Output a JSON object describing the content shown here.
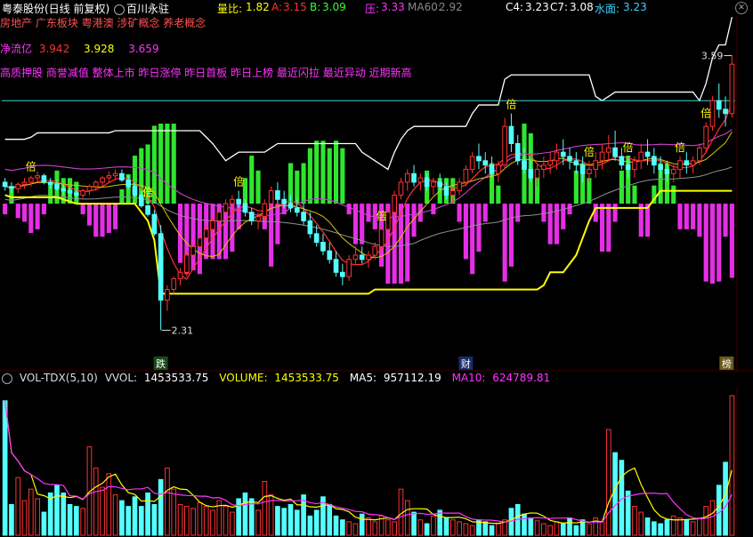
{
  "header": {
    "stock_name": "粤泰股份(日线 前复权)",
    "indicator_name": "百川永驻",
    "ratio_label": "量比:",
    "ratio_value": "1.82",
    "a_label": "A:",
    "a_value": "3.15",
    "b_label": "B:",
    "b_value": "3.09",
    "ya_label": "压:",
    "ya_value": "3.33",
    "ma60_label": "MA60:",
    "ma60_value": "2.92",
    "c4_label": "C4:",
    "c4_value": "3.23",
    "c7_label": "C7:",
    "c7_value": "3.08",
    "water_label": "水面:",
    "water_value": "3.23"
  },
  "concepts": "房地产 广东板块 粤港澳 涉矿概念 养老概念",
  "net_inflow": {
    "label": "净流亿",
    "v1": "3.942",
    "v2": "3.928",
    "v3": "3.659"
  },
  "tags": "高质押股 商誉减值 整体上市 昨日涨停 昨日首板 昨日上榜 最近闪拉 最近异动 近期新高",
  "annotations": {
    "high_label": "3.59",
    "low_label": "2.31",
    "bei": "倍",
    "die": "跌",
    "cai": "财",
    "bang": "榜"
  },
  "volume_header": {
    "name": "VOL-TDX(5,10)",
    "vvol_label": "VVOL:",
    "vvol_value": "1453533.75",
    "volume_label": "VOLUME:",
    "volume_value": "1453533.75",
    "ma5_label": "MA5:",
    "ma5_value": "957112.19",
    "ma10_label": "MA10:",
    "ma10_value": "624789.81"
  },
  "colors": {
    "bg": "#000000",
    "up": "#ff3232",
    "down": "#54ffff",
    "yellow": "#ffff00",
    "magenta": "#ff33ff",
    "green": "#33ff33",
    "white": "#ffffff",
    "cyan_line": "#40d0d0",
    "purple_line": "#d040d0"
  },
  "chart_data": [
    {
      "type": "candlestick",
      "price_range": [
        2.2,
        3.7
      ],
      "high_marker": 3.59,
      "low_marker": 2.31,
      "candles": [
        [
          3.0,
          3.02,
          2.96,
          2.98
        ],
        [
          2.98,
          3.0,
          2.95,
          2.97
        ],
        [
          2.97,
          3.0,
          2.95,
          2.99
        ],
        [
          2.99,
          3.02,
          2.97,
          3.0
        ],
        [
          3.0,
          3.03,
          2.98,
          3.02
        ],
        [
          3.02,
          3.05,
          3.0,
          3.03
        ],
        [
          3.03,
          3.04,
          2.99,
          3.0
        ],
        [
          3.0,
          3.02,
          2.97,
          2.99
        ],
        [
          2.99,
          3.01,
          2.96,
          2.97
        ],
        [
          2.97,
          2.99,
          2.94,
          2.96
        ],
        [
          2.96,
          2.98,
          2.93,
          2.95
        ],
        [
          2.95,
          2.97,
          2.92,
          2.94
        ],
        [
          2.94,
          2.97,
          2.92,
          2.96
        ],
        [
          2.96,
          2.99,
          2.94,
          2.98
        ],
        [
          2.98,
          3.01,
          2.96,
          3.0
        ],
        [
          3.0,
          3.03,
          2.98,
          3.02
        ],
        [
          3.02,
          3.05,
          3.0,
          3.03
        ],
        [
          3.03,
          3.06,
          3.01,
          3.04
        ],
        [
          3.04,
          3.06,
          3.0,
          3.01
        ],
        [
          3.01,
          3.03,
          2.97,
          2.98
        ],
        [
          2.98,
          3.0,
          2.93,
          2.94
        ],
        [
          2.94,
          2.96,
          2.88,
          2.89
        ],
        [
          2.89,
          2.91,
          2.84,
          2.85
        ],
        [
          2.85,
          2.87,
          2.75,
          2.76
        ],
        [
          2.76,
          2.8,
          2.31,
          2.45
        ],
        [
          2.45,
          2.52,
          2.4,
          2.5
        ],
        [
          2.5,
          2.56,
          2.48,
          2.55
        ],
        [
          2.55,
          2.6,
          2.52,
          2.58
        ],
        [
          2.58,
          2.68,
          2.56,
          2.66
        ],
        [
          2.66,
          2.72,
          2.64,
          2.7
        ],
        [
          2.7,
          2.76,
          2.68,
          2.74
        ],
        [
          2.74,
          2.8,
          2.72,
          2.78
        ],
        [
          2.78,
          2.84,
          2.76,
          2.82
        ],
        [
          2.82,
          2.88,
          2.8,
          2.86
        ],
        [
          2.86,
          2.92,
          2.84,
          2.9
        ],
        [
          2.9,
          2.94,
          2.86,
          2.92
        ],
        [
          2.92,
          2.96,
          2.88,
          2.9
        ],
        [
          2.9,
          2.92,
          2.84,
          2.86
        ],
        [
          2.86,
          2.88,
          2.8,
          2.82
        ],
        [
          2.82,
          2.86,
          2.78,
          2.84
        ],
        [
          2.84,
          2.92,
          2.82,
          2.9
        ],
        [
          2.9,
          2.98,
          2.88,
          2.96
        ],
        [
          2.96,
          3.0,
          2.9,
          2.92
        ],
        [
          2.92,
          2.96,
          2.88,
          2.9
        ],
        [
          2.9,
          2.94,
          2.86,
          2.88
        ],
        [
          2.88,
          2.92,
          2.84,
          2.86
        ],
        [
          2.86,
          2.9,
          2.8,
          2.82
        ],
        [
          2.82,
          2.86,
          2.74,
          2.76
        ],
        [
          2.76,
          2.8,
          2.7,
          2.72
        ],
        [
          2.72,
          2.76,
          2.66,
          2.68
        ],
        [
          2.68,
          2.72,
          2.62,
          2.64
        ],
        [
          2.64,
          2.68,
          2.56,
          2.58
        ],
        [
          2.58,
          2.62,
          2.52,
          2.56
        ],
        [
          2.56,
          2.66,
          2.54,
          2.64
        ],
        [
          2.64,
          2.7,
          2.62,
          2.66
        ],
        [
          2.66,
          2.7,
          2.62,
          2.64
        ],
        [
          2.64,
          2.68,
          2.6,
          2.66
        ],
        [
          2.66,
          2.72,
          2.64,
          2.7
        ],
        [
          2.7,
          2.8,
          2.68,
          2.78
        ],
        [
          2.78,
          2.88,
          2.76,
          2.86
        ],
        [
          2.86,
          2.96,
          2.84,
          2.94
        ],
        [
          2.94,
          3.02,
          2.92,
          3.0
        ],
        [
          3.0,
          3.06,
          2.96,
          3.04
        ],
        [
          3.04,
          3.08,
          2.98,
          3.0
        ],
        [
          3.0,
          3.04,
          2.96,
          3.02
        ],
        [
          3.02,
          3.04,
          2.96,
          2.98
        ],
        [
          2.98,
          3.02,
          2.94,
          3.0
        ],
        [
          3.0,
          3.04,
          2.96,
          2.98
        ],
        [
          2.98,
          3.0,
          2.92,
          2.94
        ],
        [
          2.94,
          2.98,
          2.9,
          2.96
        ],
        [
          2.96,
          3.02,
          2.94,
          3.0
        ],
        [
          3.0,
          3.08,
          2.98,
          3.06
        ],
        [
          3.06,
          3.14,
          3.04,
          3.12
        ],
        [
          3.12,
          3.18,
          3.06,
          3.1
        ],
        [
          3.1,
          3.14,
          3.04,
          3.08
        ],
        [
          3.08,
          3.12,
          3.02,
          3.04
        ],
        [
          3.04,
          3.1,
          3.0,
          3.08
        ],
        [
          3.08,
          3.3,
          3.06,
          3.26
        ],
        [
          3.26,
          3.32,
          3.14,
          3.18
        ],
        [
          3.18,
          3.22,
          3.08,
          3.1
        ],
        [
          3.1,
          3.16,
          3.04,
          3.06
        ],
        [
          3.06,
          3.1,
          3.0,
          3.02
        ],
        [
          3.02,
          3.08,
          2.98,
          3.06
        ],
        [
          3.06,
          3.12,
          3.02,
          3.08
        ],
        [
          3.08,
          3.14,
          3.04,
          3.1
        ],
        [
          3.1,
          3.18,
          3.06,
          3.14
        ],
        [
          3.14,
          3.2,
          3.08,
          3.12
        ],
        [
          3.12,
          3.16,
          3.06,
          3.1
        ],
        [
          3.1,
          3.14,
          3.04,
          3.08
        ],
        [
          3.08,
          3.12,
          3.0,
          3.04
        ],
        [
          3.04,
          3.1,
          3.0,
          3.06
        ],
        [
          3.06,
          3.14,
          3.02,
          3.1
        ],
        [
          3.1,
          3.18,
          3.06,
          3.14
        ],
        [
          3.14,
          3.22,
          3.1,
          3.16
        ],
        [
          3.16,
          3.24,
          3.1,
          3.12
        ],
        [
          3.12,
          3.16,
          3.06,
          3.08
        ],
        [
          3.08,
          3.12,
          3.02,
          3.06
        ],
        [
          3.06,
          3.12,
          3.02,
          3.1
        ],
        [
          3.1,
          3.18,
          3.06,
          3.14
        ],
        [
          3.14,
          3.2,
          3.08,
          3.12
        ],
        [
          3.12,
          3.16,
          3.04,
          3.08
        ],
        [
          3.08,
          3.12,
          3.02,
          3.06
        ],
        [
          3.06,
          3.1,
          3.0,
          3.04
        ],
        [
          3.04,
          3.08,
          3.0,
          3.06
        ],
        [
          3.06,
          3.12,
          3.02,
          3.1
        ],
        [
          3.1,
          3.14,
          3.04,
          3.08
        ],
        [
          3.08,
          3.12,
          3.04,
          3.1
        ],
        [
          3.1,
          3.18,
          3.08,
          3.16
        ],
        [
          3.16,
          3.28,
          3.14,
          3.26
        ],
        [
          3.26,
          3.4,
          3.24,
          3.38
        ],
        [
          3.38,
          3.46,
          3.3,
          3.34
        ],
        [
          3.34,
          3.4,
          3.26,
          3.32
        ],
        [
          3.32,
          3.59,
          3.3,
          3.55
        ]
      ]
    },
    {
      "type": "bar",
      "series": [
        {
          "name": "VOLUME",
          "values": [
            1400000,
            320000,
            600000,
            360000,
            480000,
            380000,
            240000,
            440000,
            520000,
            440000,
            320000,
            300000,
            280000,
            920000,
            700000,
            500000,
            640000,
            420000,
            360000,
            300000,
            400000,
            300000,
            440000,
            320000,
            580000,
            700000,
            480000,
            320000,
            300000,
            280000,
            340000,
            300000,
            260000,
            360000,
            300000,
            240000,
            380000,
            440000,
            380000,
            260000,
            560000,
            420000,
            300000,
            280000,
            320000,
            260000,
            420000,
            200000,
            260000,
            400000,
            320000,
            200000,
            160000,
            140000,
            120000,
            220000,
            180000,
            140000,
            200000,
            160000,
            140000,
            480000,
            360000,
            240000,
            160000,
            120000,
            200000,
            260000,
            180000,
            160000,
            140000,
            120000,
            100000,
            160000,
            140000,
            100000,
            120000,
            160000,
            280000,
            320000,
            220000,
            180000,
            150000,
            120000,
            100000,
            140000,
            120000,
            180000,
            100000,
            160000,
            120000,
            180000,
            140000,
            1100000,
            860000,
            780000,
            460000,
            300000,
            240000,
            180000,
            140000,
            120000,
            160000,
            200000,
            180000,
            160000,
            140000,
            180000,
            300000,
            360000,
            520000,
            760000,
            1453534
          ]
        },
        {
          "name": "MA5",
          "values": []
        },
        {
          "name": "MA10",
          "values": []
        }
      ],
      "ylim": [
        0,
        1500000
      ]
    }
  ]
}
